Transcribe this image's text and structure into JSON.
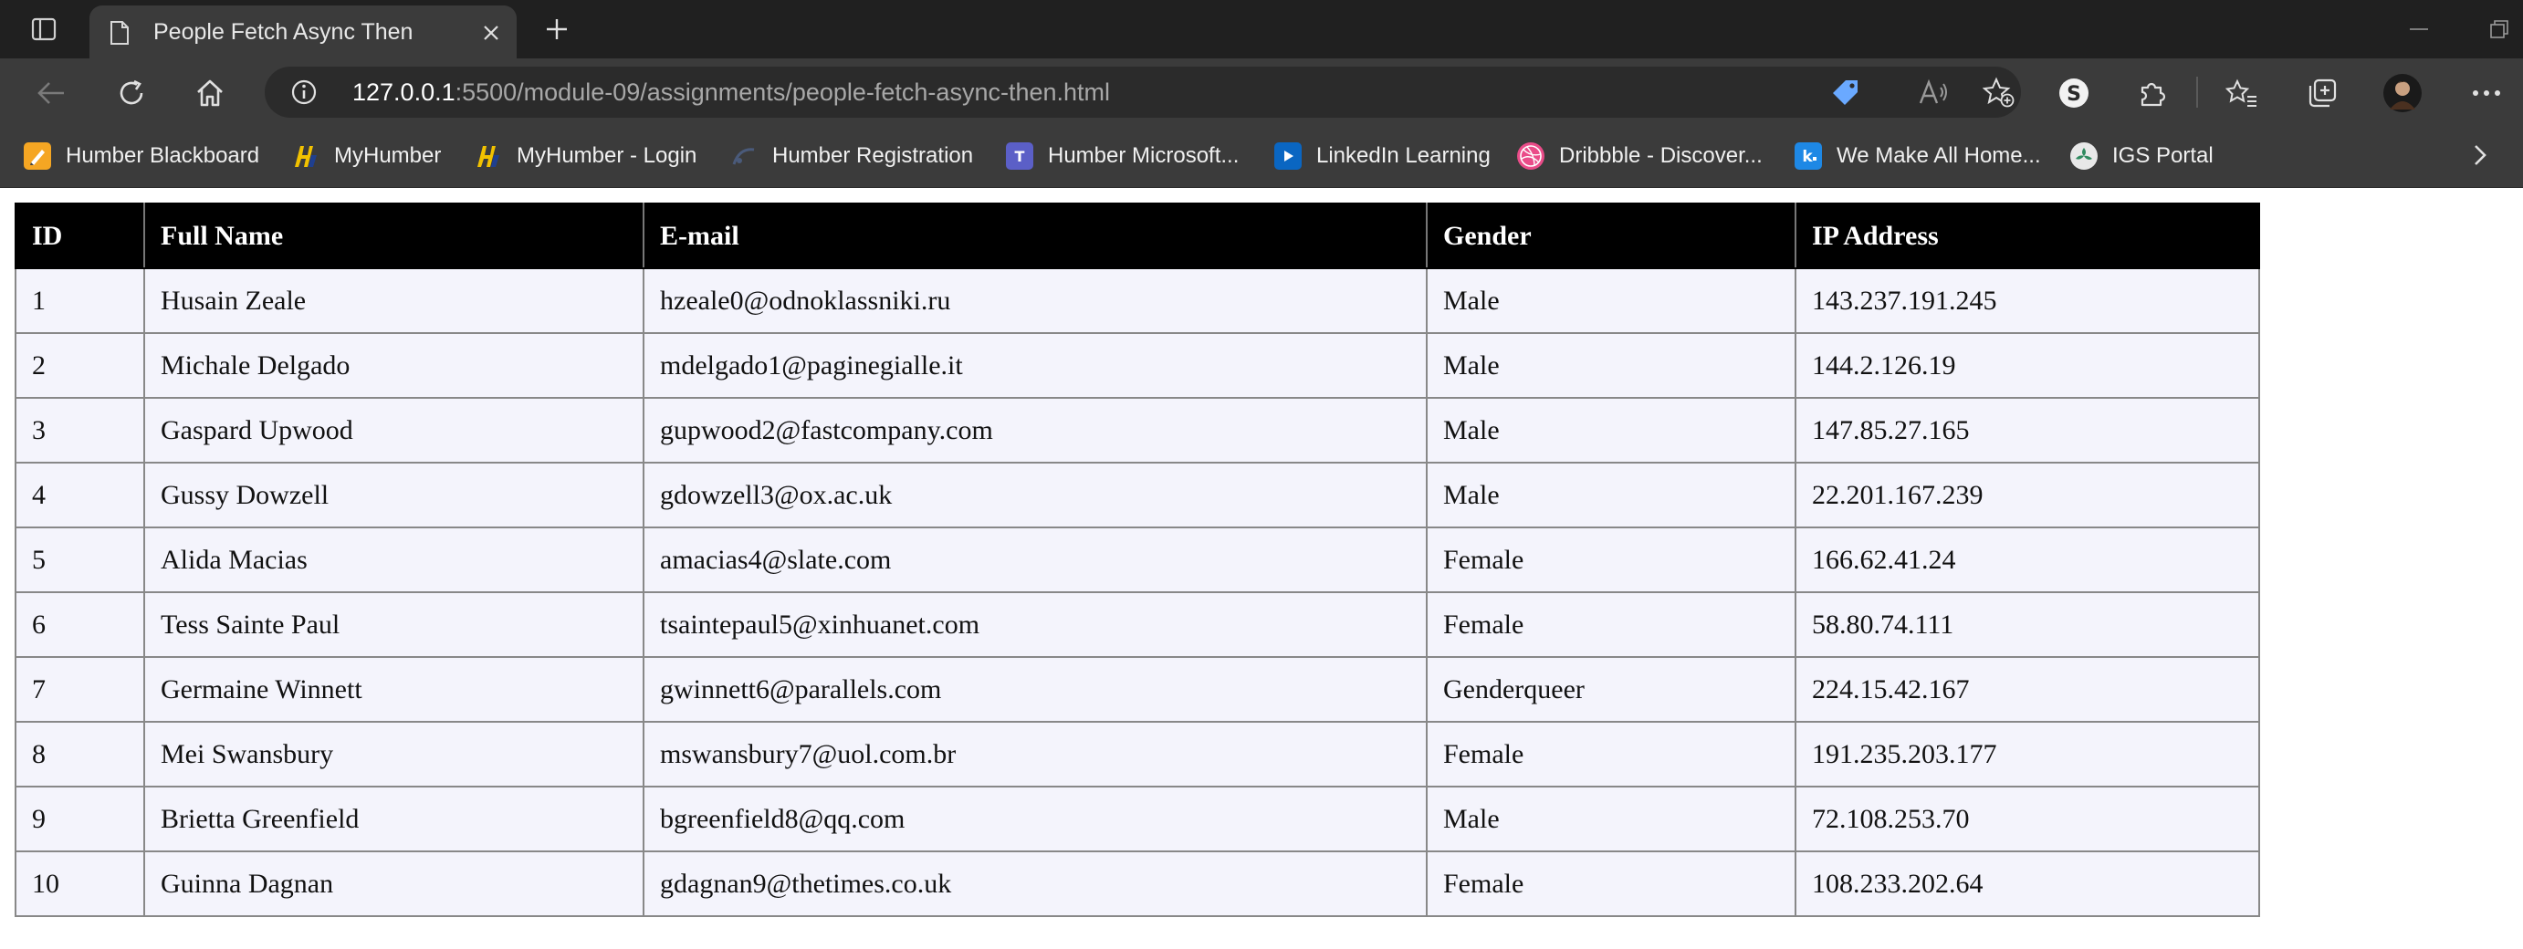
{
  "browser": {
    "tab": {
      "title": "People Fetch Async Then"
    },
    "address_bar": {
      "url_host": "127.0.0.1",
      "url_rest": ":5500/module-09/assignments/people-fetch-async-then.html"
    },
    "favorites": [
      {
        "label": "Humber Blackboard",
        "icon": "blackboard-icon",
        "color": "#f5a623"
      },
      {
        "label": "MyHumber",
        "icon": "humber-icon",
        "color": "#f2c200"
      },
      {
        "label": "MyHumber - Login",
        "icon": "humber-icon",
        "color": "#f2c200"
      },
      {
        "label": "Humber Registration",
        "icon": "registration-icon",
        "color": "#3a4a6a"
      },
      {
        "label": "Humber Microsoft...",
        "icon": "teams-icon",
        "color": "#5b5fc7"
      },
      {
        "label": "LinkedIn Learning",
        "icon": "linkedin-learning-icon",
        "color": "#0a66c2"
      },
      {
        "label": "Dribbble - Discover...",
        "icon": "dribbble-icon",
        "color": "#ea4c89"
      },
      {
        "label": "We Make All Home...",
        "icon": "k-icon",
        "color": "#1e88e5"
      },
      {
        "label": "IGS Portal",
        "icon": "igs-icon",
        "color": "#e8e8e8"
      }
    ]
  },
  "table": {
    "headers": [
      "ID",
      "Full Name",
      "E-mail",
      "Gender",
      "IP Address"
    ],
    "rows": [
      [
        "1",
        "Husain Zeale",
        "hzeale0@odnoklassniki.ru",
        "Male",
        "143.237.191.245"
      ],
      [
        "2",
        "Michale Delgado",
        "mdelgado1@paginegialle.it",
        "Male",
        "144.2.126.19"
      ],
      [
        "3",
        "Gaspard Upwood",
        "gupwood2@fastcompany.com",
        "Male",
        "147.85.27.165"
      ],
      [
        "4",
        "Gussy Dowzell",
        "gdowzell3@ox.ac.uk",
        "Male",
        "22.201.167.239"
      ],
      [
        "5",
        "Alida Macias",
        "amacias4@slate.com",
        "Female",
        "166.62.41.24"
      ],
      [
        "6",
        "Tess Sainte Paul",
        "tsaintepaul5@xinhuanet.com",
        "Female",
        "58.80.74.111"
      ],
      [
        "7",
        "Germaine Winnett",
        "gwinnett6@parallels.com",
        "Genderqueer",
        "224.15.42.167"
      ],
      [
        "8",
        "Mei Swansbury",
        "mswansbury7@uol.com.br",
        "Female",
        "191.235.203.177"
      ],
      [
        "9",
        "Brietta Greenfield",
        "bgreenfield8@qq.com",
        "Male",
        "72.108.253.70"
      ],
      [
        "10",
        "Guinna Dagnan",
        "gdagnan9@thetimes.co.uk",
        "Female",
        "108.233.202.64"
      ]
    ]
  }
}
